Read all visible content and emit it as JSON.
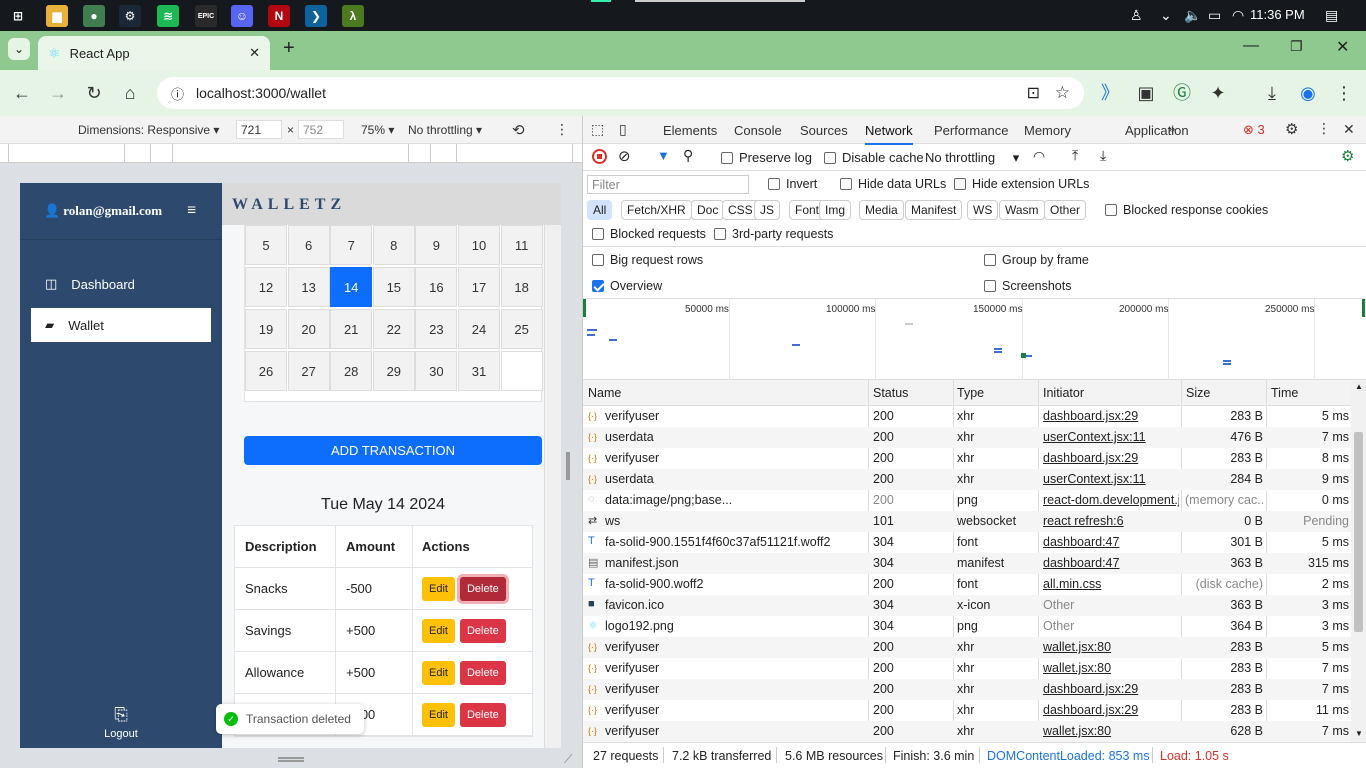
{
  "taskbar": {
    "clock": "11:36 PM",
    "apps": [
      {
        "name": "windows-start",
        "glyph": "⊞",
        "color": "#15181c"
      },
      {
        "name": "file-explorer",
        "glyph": "▆",
        "color": "#e8b13a"
      },
      {
        "name": "chrome",
        "glyph": "●",
        "color": "#3f7f4f"
      },
      {
        "name": "steam",
        "glyph": "⚙",
        "color": "#1b2838"
      },
      {
        "name": "spotify",
        "glyph": "≋",
        "color": "#1db954"
      },
      {
        "name": "epic-games",
        "glyph": "EPIC",
        "color": "#2a2a2a"
      },
      {
        "name": "discord",
        "glyph": "☺",
        "color": "#5865f2"
      },
      {
        "name": "netflix",
        "glyph": "N",
        "color": "#b20710"
      },
      {
        "name": "vscode",
        "glyph": "❯",
        "color": "#0e639c"
      },
      {
        "name": "lambda-app",
        "glyph": "λ",
        "color": "#4c7a1f"
      }
    ]
  },
  "browser": {
    "tab_title": "React App",
    "url": "localhost:3000/wallet"
  },
  "device_toolbar": {
    "dimensions": "Dimensions: Responsive",
    "width": "721",
    "height": "752",
    "zoom": "75%",
    "throttling": "No throttling"
  },
  "app": {
    "user_email": "rolan@gmail.com",
    "brand": "WALLETZ",
    "nav": [
      {
        "label": "Dashboard",
        "active": false
      },
      {
        "label": "Wallet",
        "active": true
      }
    ],
    "logout_label": "Logout",
    "calendar_rows": [
      [
        "5",
        "6",
        "7",
        "8",
        "9",
        "10",
        "11"
      ],
      [
        "12",
        "13",
        "14",
        "15",
        "16",
        "17",
        "18"
      ],
      [
        "19",
        "20",
        "21",
        "22",
        "23",
        "24",
        "25"
      ],
      [
        "26",
        "27",
        "28",
        "29",
        "30",
        "31",
        ""
      ]
    ],
    "selected_day": "14",
    "add_transaction_label": "ADD TRANSACTION",
    "date_title": "Tue May 14 2024",
    "table_headers": [
      "Description",
      "Amount",
      "Actions"
    ],
    "transactions": [
      {
        "description": "Snacks",
        "amount": "-500"
      },
      {
        "description": "Savings",
        "amount": "+500"
      },
      {
        "description": "Allowance",
        "amount": "+500"
      },
      {
        "description": "",
        "amount": "+500"
      }
    ],
    "edit_label": "Edit",
    "delete_label": "Delete",
    "toast": "Transaction deleted"
  },
  "devtools": {
    "tabs": [
      "Elements",
      "Console",
      "Sources",
      "Network",
      "Performance",
      "Memory",
      "Application"
    ],
    "active_tab": "Network",
    "error_count": "3",
    "preserve_log": "Preserve log",
    "disable_cache": "Disable cache",
    "throttle": "No throttling",
    "filter_placeholder": "Filter",
    "invert": "Invert",
    "hide_data_urls": "Hide data URLs",
    "hide_extension_urls": "Hide extension URLs",
    "type_filters": [
      "All",
      "Fetch/XHR",
      "Doc",
      "CSS",
      "JS",
      "Font",
      "Img",
      "Media",
      "Manifest",
      "WS",
      "Wasm",
      "Other"
    ],
    "blocked_response_cookies": "Blocked response cookies",
    "blocked_requests": "Blocked requests",
    "third_party": "3rd-party requests",
    "big_request_rows": "Big request rows",
    "group_by_frame": "Group by frame",
    "overview": "Overview",
    "screenshots": "Screenshots",
    "timeline_labels": [
      "50000 ms",
      "100000 ms",
      "150000 ms",
      "200000 ms",
      "250000 ms"
    ],
    "columns": [
      "Name",
      "Status",
      "Type",
      "Initiator",
      "Size",
      "Time"
    ],
    "requests": [
      {
        "name": "verifyuser",
        "status": "200",
        "type": "xhr",
        "initiator": "dashboard.jsx:29",
        "size": "283 B",
        "time": "5 ms",
        "icon": "xhr"
      },
      {
        "name": "userdata",
        "status": "200",
        "type": "xhr",
        "initiator": "userContext.jsx:11",
        "size": "476 B",
        "time": "7 ms",
        "icon": "xhr"
      },
      {
        "name": "verifyuser",
        "status": "200",
        "type": "xhr",
        "initiator": "dashboard.jsx:29",
        "size": "283 B",
        "time": "8 ms",
        "icon": "xhr"
      },
      {
        "name": "userdata",
        "status": "200",
        "type": "xhr",
        "initiator": "userContext.jsx:11",
        "size": "284 B",
        "time": "9 ms",
        "icon": "xhr"
      },
      {
        "name": "data:image/png;base...",
        "status": "200",
        "type": "png",
        "initiator": "react-dom.development.js",
        "size": "(memory cac...",
        "time": "0 ms",
        "icon": "img"
      },
      {
        "name": "ws",
        "status": "101",
        "type": "websocket",
        "initiator": "react refresh:6",
        "size": "0 B",
        "time": "Pending",
        "icon": "ws"
      },
      {
        "name": "fa-solid-900.1551f4f60c37af51121f.woff2",
        "status": "304",
        "type": "font",
        "initiator": "dashboard:47",
        "size": "301 B",
        "time": "5 ms",
        "icon": "font"
      },
      {
        "name": "manifest.json",
        "status": "304",
        "type": "manifest",
        "initiator": "dashboard:47",
        "size": "363 B",
        "time": "315 ms",
        "icon": "doc"
      },
      {
        "name": "fa-solid-900.woff2",
        "status": "200",
        "type": "font",
        "initiator": "all.min.css",
        "size": "(disk cache)",
        "time": "2 ms",
        "icon": "font"
      },
      {
        "name": "favicon.ico",
        "status": "304",
        "type": "x-icon",
        "initiator": "Other",
        "size": "363 B",
        "time": "3 ms",
        "icon": "ico"
      },
      {
        "name": "logo192.png",
        "status": "304",
        "type": "png",
        "initiator": "Other",
        "size": "364 B",
        "time": "3 ms",
        "icon": "react"
      },
      {
        "name": "verifyuser",
        "status": "200",
        "type": "xhr",
        "initiator": "wallet.jsx:80",
        "size": "283 B",
        "time": "5 ms",
        "icon": "xhr"
      },
      {
        "name": "verifyuser",
        "status": "200",
        "type": "xhr",
        "initiator": "wallet.jsx:80",
        "size": "283 B",
        "time": "7 ms",
        "icon": "xhr"
      },
      {
        "name": "verifyuser",
        "status": "200",
        "type": "xhr",
        "initiator": "dashboard.jsx:29",
        "size": "283 B",
        "time": "7 ms",
        "icon": "xhr"
      },
      {
        "name": "verifyuser",
        "status": "200",
        "type": "xhr",
        "initiator": "dashboard.jsx:29",
        "size": "283 B",
        "time": "11 ms",
        "icon": "xhr"
      },
      {
        "name": "verifyuser",
        "status": "200",
        "type": "xhr",
        "initiator": "wallet.jsx:80",
        "size": "628 B",
        "time": "7 ms",
        "icon": "xhr"
      }
    ],
    "status_bar": {
      "requests": "27 requests",
      "transferred": "7.2 kB transferred",
      "resources": "5.6 MB resources",
      "finish": "Finish: 3.6 min",
      "dcl": "DOMContentLoaded: 853 ms",
      "load": "Load: 1.05 s"
    }
  },
  "colors": {
    "sidebar": "#2d4a6e",
    "accent": "#0d6efd",
    "edit": "#ffc107",
    "delete": "#dc3545",
    "chrome_frame": "#8fc98f",
    "load_red": "#d93025",
    "dcl_blue": "#1a73e8"
  }
}
